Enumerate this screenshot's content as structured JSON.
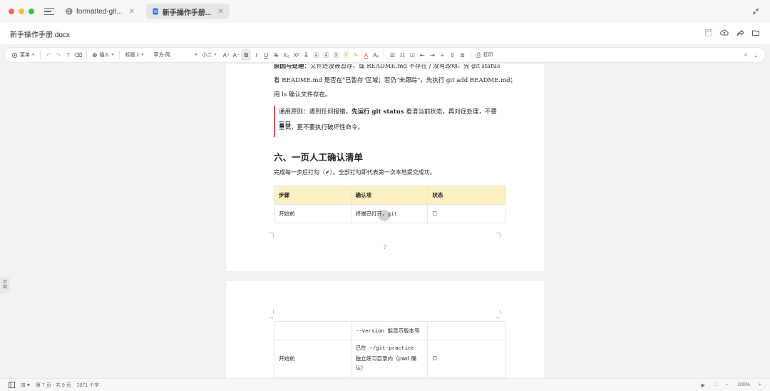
{
  "window": {
    "tabs": [
      {
        "label": "formatted-git...",
        "icon": "globe-icon",
        "active": false
      },
      {
        "label": "新手操作手册...",
        "icon": "doc-icon",
        "active": true
      }
    ],
    "tab_close": "✕"
  },
  "doc": {
    "filename": "新手操作手册.docx"
  },
  "toolbar": {
    "menu": "菜单",
    "insert": "插入",
    "heading_style": "标题 1",
    "font": "苹方-简",
    "font_size": "小二",
    "print": "打印"
  },
  "sidebar": {
    "outline_label_1": "大",
    "outline_label_2": "纲"
  },
  "page7": {
    "line1_bold": "原因与处理",
    "line1_rest": "：文件还没被暂存，或 README.md 不存在 / 没有改动。先 git status",
    "line2": "看 README.md 是否在\"已暂存\"区域；若仍\"未跟踪\"，先执行 git add README.md；",
    "line3": "用 ls 确认文件存在。",
    "callout_a": "通用原则：遇到任何报错，",
    "callout_bold": "先运行 git status",
    "callout_b": " 看清当前状态，再对症处理，不要盲目",
    "callout_line2": "重试，更不要执行破坏性命令。",
    "heading": "六、一页人工确认清单",
    "para": "完成每一步后打勾（✔）。全部打勾即代表第一次本地提交成功。",
    "table": {
      "headers": [
        "步骤",
        "确认项",
        "状态"
      ],
      "rows": [
        [
          "开始前",
          "终端已打开，git",
          "☐"
        ]
      ]
    },
    "page_number": "7"
  },
  "page8": {
    "row1": [
      "",
      "--version 能显示版本号",
      ""
    ],
    "row2_step": "开始前",
    "row2_item_lines": [
      "已在 ~/git-practice",
      "独立练习目录内（pwd 确",
      "认）"
    ],
    "row2_status": "☐"
  },
  "status": {
    "page_info": "第 7 页 - 共 9 页",
    "word_count": "2971 个字",
    "zoom": "100%"
  },
  "colors": {
    "table_header_bg": "#fdf0c2",
    "callout_bar": "#e35350",
    "active_tab_bg": "#e4e6ea"
  }
}
